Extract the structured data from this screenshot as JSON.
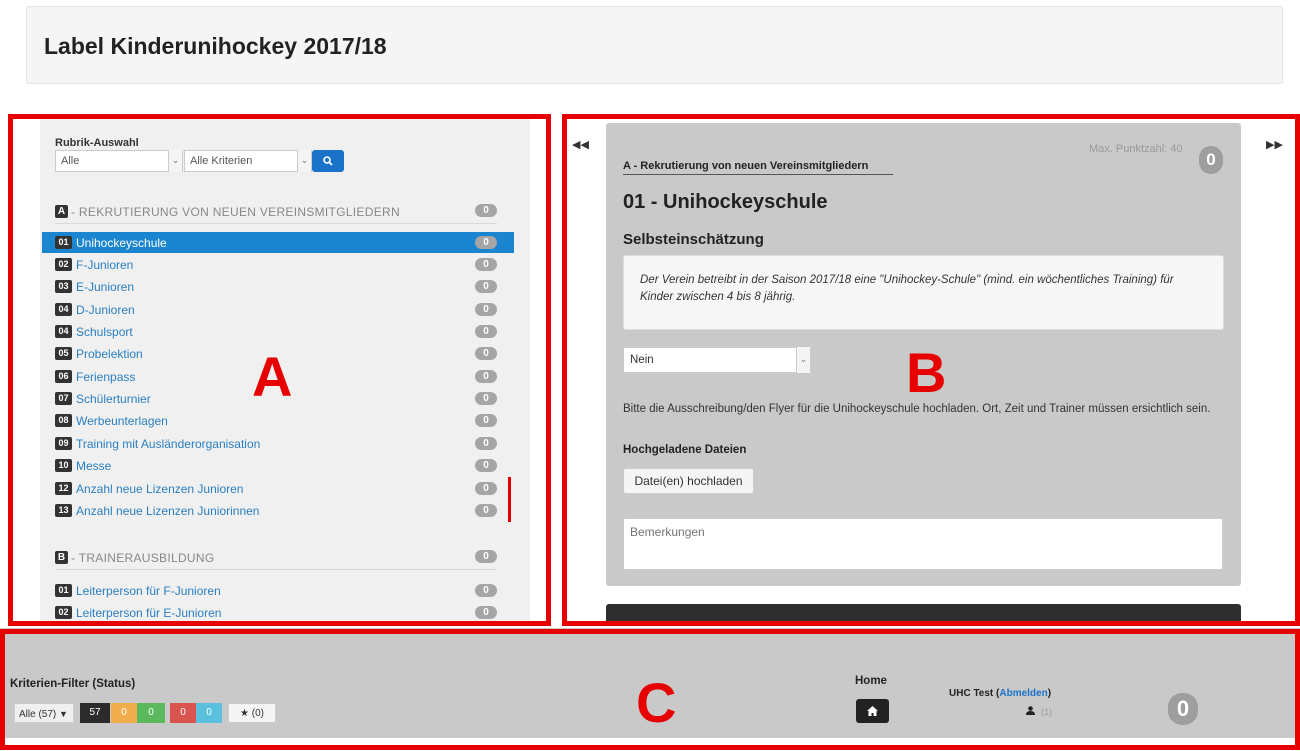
{
  "header": {
    "title": "Label Kinderunihockey 2017/18"
  },
  "sidebar": {
    "rubrik_label": "Rubrik-Auswahl",
    "select_all": "Alle",
    "select_criteria": "Alle Kriterien",
    "categories": [
      {
        "letter": "A",
        "title": "- REKRUTIERUNG VON NEUEN VEREINSMITGLIEDERN",
        "badge": "0"
      },
      {
        "letter": "B",
        "title": "- TRAINERAUSBILDUNG",
        "badge": "0"
      }
    ],
    "items_a": [
      {
        "num": "01",
        "label": "Unihockeyschule",
        "badge": "0"
      },
      {
        "num": "02",
        "label": "F-Junioren",
        "badge": "0"
      },
      {
        "num": "03",
        "label": "E-Junioren",
        "badge": "0"
      },
      {
        "num": "04",
        "label": "D-Junioren",
        "badge": "0"
      },
      {
        "num": "04",
        "label": "Schulsport",
        "badge": "0"
      },
      {
        "num": "05",
        "label": "Probelektion",
        "badge": "0"
      },
      {
        "num": "06",
        "label": "Ferienpass",
        "badge": "0"
      },
      {
        "num": "07",
        "label": "Schülerturnier",
        "badge": "0"
      },
      {
        "num": "08",
        "label": "Werbeunterlagen",
        "badge": "0"
      },
      {
        "num": "09",
        "label": "Training mit Ausländerorganisation",
        "badge": "0"
      },
      {
        "num": "10",
        "label": "Messe",
        "badge": "0"
      },
      {
        "num": "12",
        "label": "Anzahl neue Lizenzen Junioren",
        "badge": "0"
      },
      {
        "num": "13",
        "label": "Anzahl neue Lizenzen Juniorinnen",
        "badge": "0"
      }
    ],
    "items_b": [
      {
        "num": "01",
        "label": "Leiterperson für F-Junioren",
        "badge": "0"
      },
      {
        "num": "02",
        "label": "Leiterperson für E-Junioren",
        "badge": "0"
      }
    ]
  },
  "detail": {
    "max_points": "Max. Punktzahl: 40",
    "score": "0",
    "breadcrumb": "A - Rekrutierung von neuen Vereinsmitgliedern",
    "title": "01 - Unihockeyschule",
    "subtitle": "Selbsteinschätzung",
    "description": "Der Verein betreibt in der Saison 2017/18 eine \"Unihockey-Schule\" (mind. ein wöchentliches Training) für Kinder zwischen 4 bis 8 jährig.",
    "select_value": "Nein",
    "note": "Bitte die Ausschreibung/den Flyer für die Unihockeyschule hochladen. Ort, Zeit und Trainer müssen ersichtlich sein.",
    "uploaded_label": "Hochgeladene Dateien",
    "upload_button": "Datei(en) hochladen",
    "remarks_placeholder": "Bemerkungen"
  },
  "footer": {
    "filter_label": "Kriterien-Filter (Status)",
    "filter_all": "Alle (57)",
    "filter_counts": [
      "57",
      "0",
      "0",
      "0",
      "0"
    ],
    "filter_star": "★ (0)",
    "home_label": "Home",
    "user_name": "UHC Test",
    "logout": "Abmelden",
    "user_count": "(1)",
    "total": "0"
  },
  "annotations": [
    "A",
    "B",
    "C"
  ],
  "colors": {
    "accent": "#1b86cf",
    "annotation": "#e60000"
  }
}
